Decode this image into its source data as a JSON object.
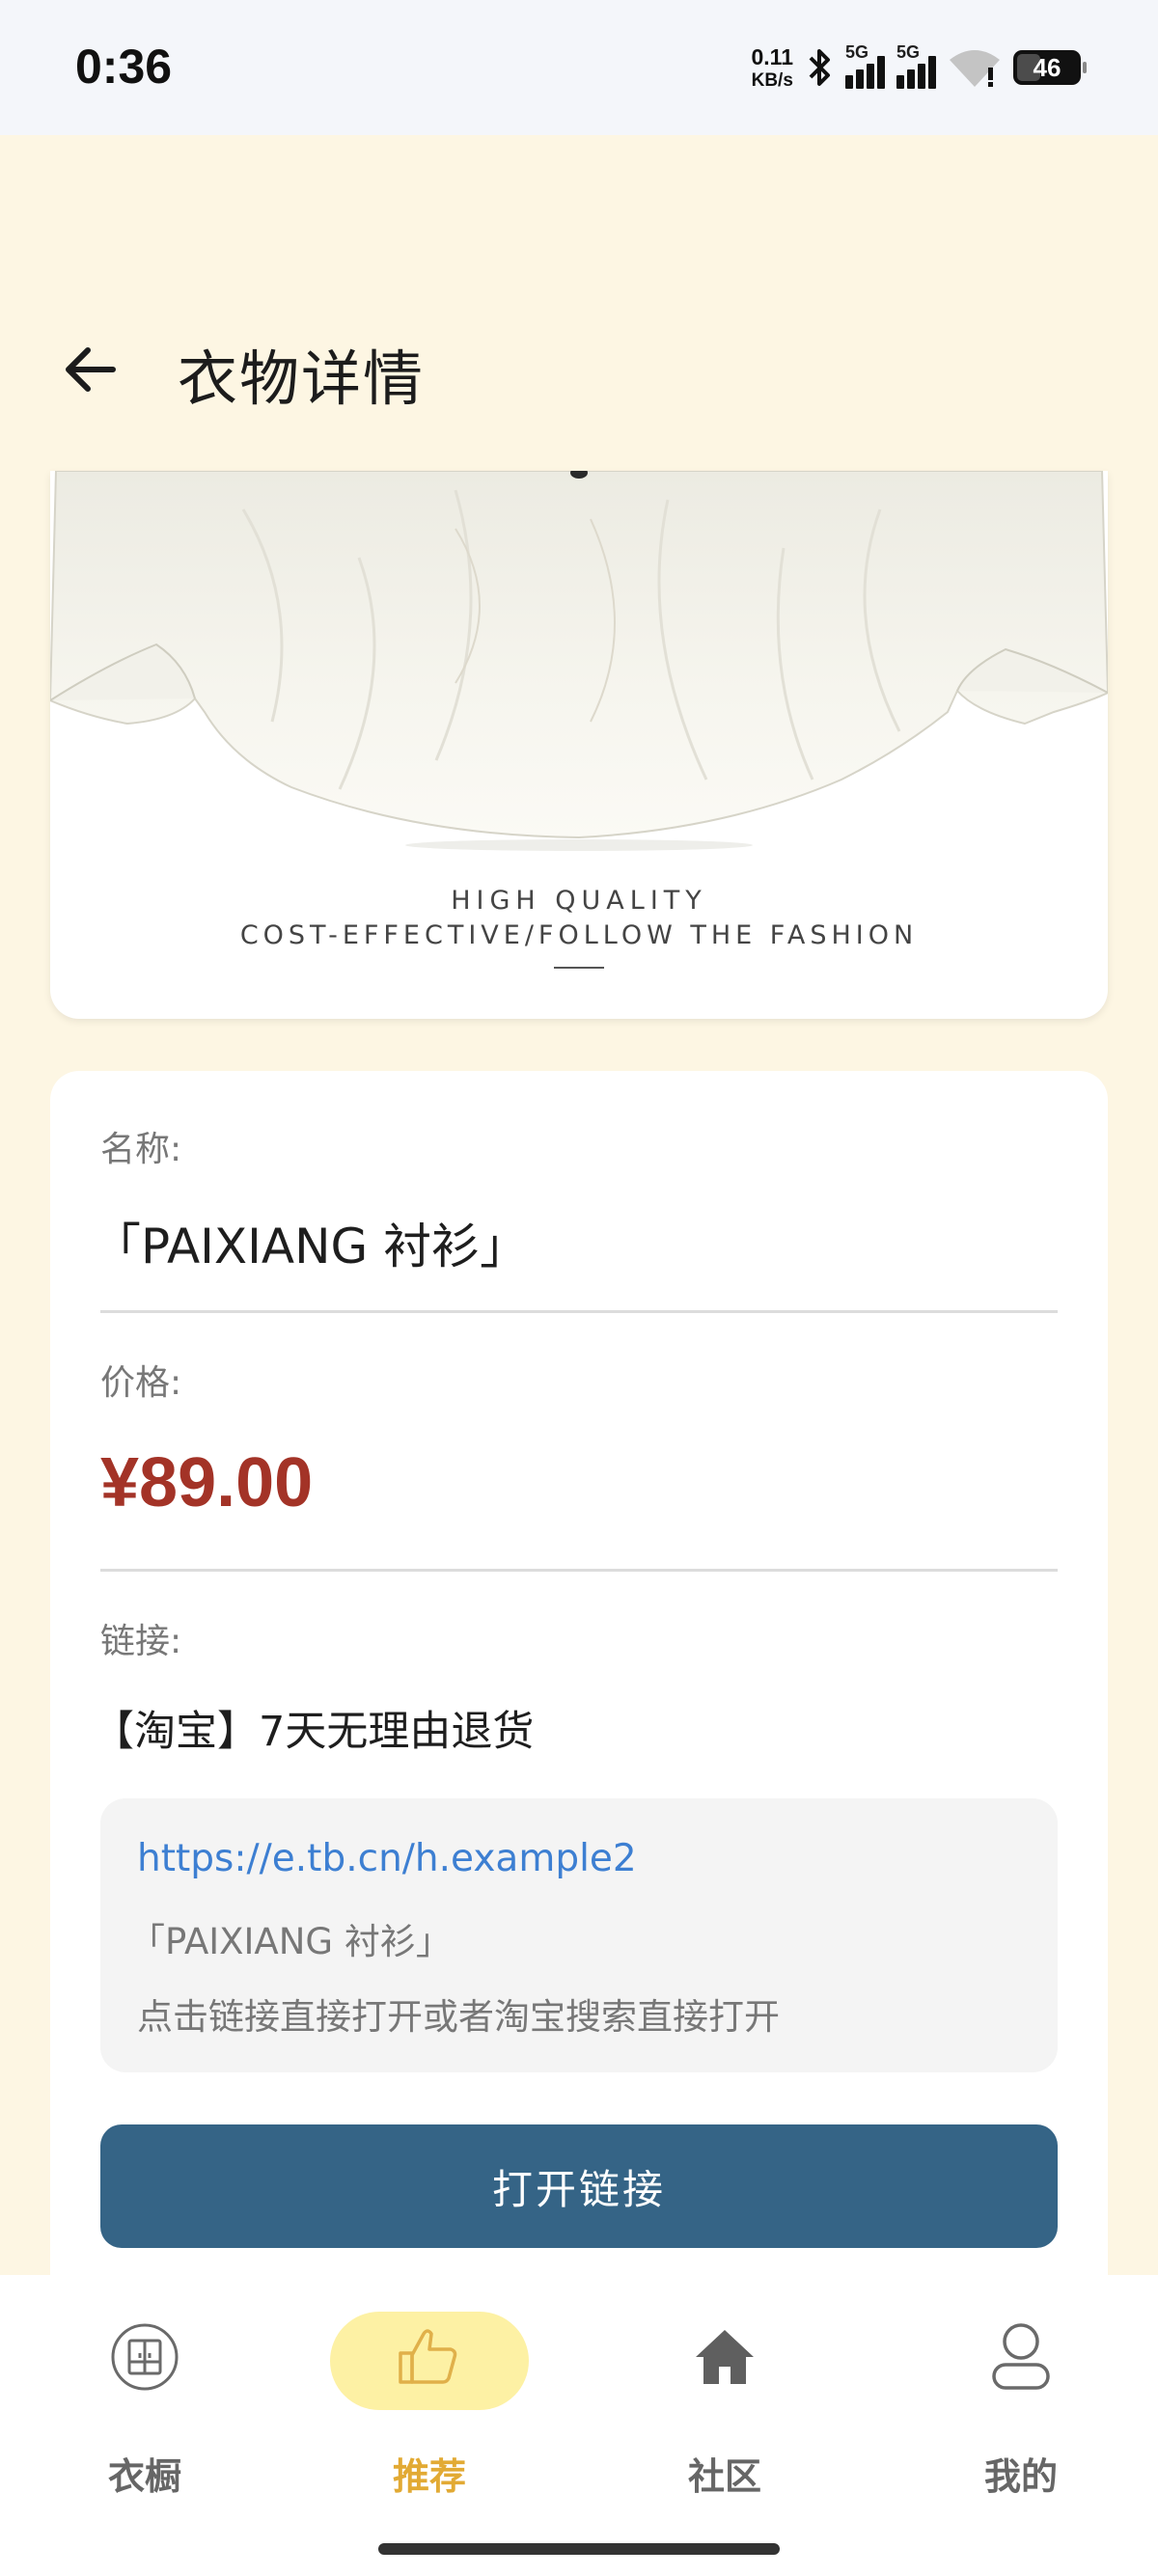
{
  "status_bar": {
    "time": "0:36",
    "net_speed_value": "0.11",
    "net_speed_unit": "KB/s",
    "sim1_label": "5G",
    "sim2_label": "5G",
    "battery": "46"
  },
  "header": {
    "title": "衣物详情"
  },
  "image_card": {
    "caption_line1": "HIGH QUALITY",
    "caption_line2": "COST-EFFECTIVE/FOLLOW THE FASHION"
  },
  "details": {
    "name_label": "名称:",
    "name_value": "「PAIXIANG 衬衫」",
    "price_label": "价格:",
    "price_value": "¥89.00",
    "link_label": "链接:",
    "link_title": "【淘宝】7天无理由退货",
    "link_url": "https://e.tb.cn/h.example2",
    "link_name": "「PAIXIANG 衬衫」",
    "link_tip": "点击链接直接打开或者淘宝搜索直接打开",
    "open_button": "打开链接"
  },
  "bottom_nav": {
    "items": [
      {
        "label": "衣橱",
        "icon": "wardrobe-icon"
      },
      {
        "label": "推荐",
        "icon": "thumbs-up-icon",
        "active": true
      },
      {
        "label": "社区",
        "icon": "home-icon"
      },
      {
        "label": "我的",
        "icon": "profile-icon"
      }
    ]
  },
  "colors": {
    "background": "#fdf6e3",
    "price": "#a33327",
    "link": "#3d7fd2",
    "button": "#356486",
    "nav_active": "#e2aa34",
    "nav_active_pill": "#fdf1a4"
  }
}
